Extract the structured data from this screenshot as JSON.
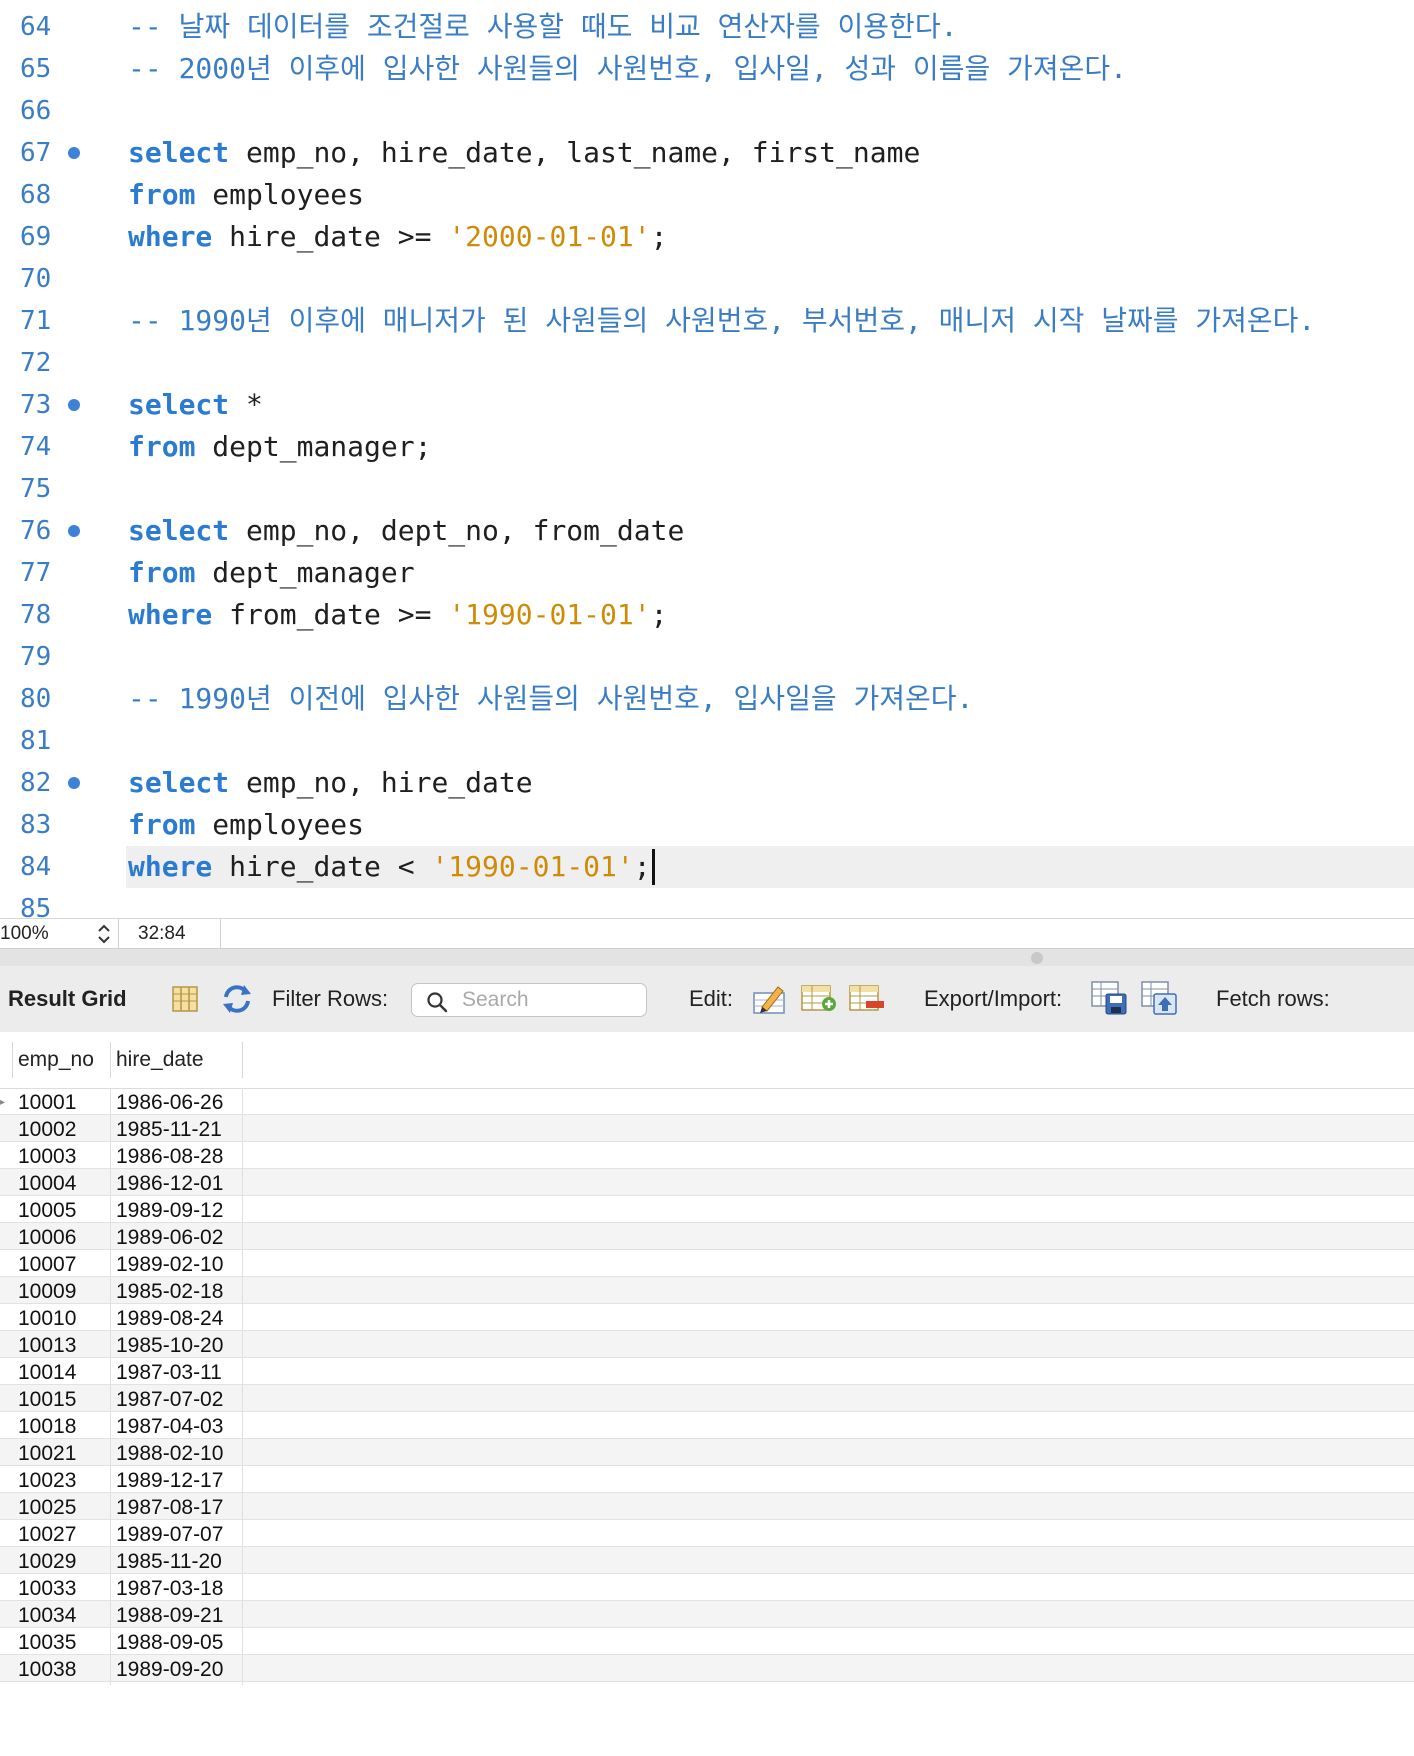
{
  "editor": {
    "lines": [
      {
        "n": "64",
        "dot": false,
        "tokens": [
          {
            "t": "-- 날짜 데이터를 조건절로 사용할 때도 비교 연산자를 이용한다.",
            "c": "cm"
          }
        ]
      },
      {
        "n": "65",
        "dot": false,
        "tokens": [
          {
            "t": "-- 2000년 이후에 입사한 사원들의 사원번호, 입사일, 성과 이름을 가져온다.",
            "c": "cm"
          }
        ]
      },
      {
        "n": "66",
        "dot": false,
        "tokens": []
      },
      {
        "n": "67",
        "dot": true,
        "tokens": [
          {
            "t": "select",
            "c": "kw"
          },
          {
            "t": " emp_no, hire_date, last_name, first_name",
            "c": ""
          }
        ]
      },
      {
        "n": "68",
        "dot": false,
        "tokens": [
          {
            "t": "from",
            "c": "kw"
          },
          {
            "t": " employees",
            "c": ""
          }
        ]
      },
      {
        "n": "69",
        "dot": false,
        "tokens": [
          {
            "t": "where",
            "c": "kw"
          },
          {
            "t": " hire_date >= ",
            "c": ""
          },
          {
            "t": "'2000-01-01'",
            "c": "str"
          },
          {
            "t": ";",
            "c": ""
          }
        ]
      },
      {
        "n": "70",
        "dot": false,
        "tokens": []
      },
      {
        "n": "71",
        "dot": false,
        "tokens": [
          {
            "t": "-- 1990년 이후에 매니저가 된 사원들의 사원번호, 부서번호, 매니저 시작 날짜를 가져온다.",
            "c": "cm"
          }
        ]
      },
      {
        "n": "72",
        "dot": false,
        "tokens": []
      },
      {
        "n": "73",
        "dot": true,
        "tokens": [
          {
            "t": "select",
            "c": "kw"
          },
          {
            "t": " *",
            "c": ""
          }
        ]
      },
      {
        "n": "74",
        "dot": false,
        "tokens": [
          {
            "t": "from",
            "c": "kw"
          },
          {
            "t": " dept_manager;",
            "c": ""
          }
        ]
      },
      {
        "n": "75",
        "dot": false,
        "tokens": []
      },
      {
        "n": "76",
        "dot": true,
        "tokens": [
          {
            "t": "select",
            "c": "kw"
          },
          {
            "t": " emp_no, dept_no, from_date",
            "c": ""
          }
        ]
      },
      {
        "n": "77",
        "dot": false,
        "tokens": [
          {
            "t": "from",
            "c": "kw"
          },
          {
            "t": " dept_manager",
            "c": ""
          }
        ]
      },
      {
        "n": "78",
        "dot": false,
        "tokens": [
          {
            "t": "where",
            "c": "kw"
          },
          {
            "t": " from_date >= ",
            "c": ""
          },
          {
            "t": "'1990-01-01'",
            "c": "str"
          },
          {
            "t": ";",
            "c": ""
          }
        ]
      },
      {
        "n": "79",
        "dot": false,
        "tokens": []
      },
      {
        "n": "80",
        "dot": false,
        "tokens": [
          {
            "t": "-- 1990년 이전에 입사한 사원들의 사원번호, 입사일을 가져온다.",
            "c": "cm"
          }
        ]
      },
      {
        "n": "81",
        "dot": false,
        "tokens": []
      },
      {
        "n": "82",
        "dot": true,
        "tokens": [
          {
            "t": "select",
            "c": "kw"
          },
          {
            "t": " emp_no, hire_date",
            "c": ""
          }
        ]
      },
      {
        "n": "83",
        "dot": false,
        "tokens": [
          {
            "t": "from",
            "c": "kw"
          },
          {
            "t": " employees",
            "c": ""
          }
        ]
      },
      {
        "n": "84",
        "dot": false,
        "current": true,
        "tokens": [
          {
            "t": "where",
            "c": "kw"
          },
          {
            "t": " hire_date < ",
            "c": ""
          },
          {
            "t": "'1990-01-01'",
            "c": "str"
          },
          {
            "t": ";",
            "c": ""
          }
        ]
      },
      {
        "n": "85",
        "dot": false,
        "tokens": []
      }
    ]
  },
  "status": {
    "zoom": "100%",
    "cursor": "32:84"
  },
  "toolbar": {
    "result_grid_label": "Result Grid",
    "filter_label": "Filter Rows:",
    "search_placeholder": "Search",
    "edit_label": "Edit:",
    "export_label": "Export/Import:",
    "fetch_label": "Fetch rows:"
  },
  "grid": {
    "columns": [
      "emp_no",
      "hire_date"
    ],
    "rows": [
      [
        "10001",
        "1986-06-26"
      ],
      [
        "10002",
        "1985-11-21"
      ],
      [
        "10003",
        "1986-08-28"
      ],
      [
        "10004",
        "1986-12-01"
      ],
      [
        "10005",
        "1989-09-12"
      ],
      [
        "10006",
        "1989-06-02"
      ],
      [
        "10007",
        "1989-02-10"
      ],
      [
        "10009",
        "1985-02-18"
      ],
      [
        "10010",
        "1989-08-24"
      ],
      [
        "10013",
        "1985-10-20"
      ],
      [
        "10014",
        "1987-03-11"
      ],
      [
        "10015",
        "1987-07-02"
      ],
      [
        "10018",
        "1987-04-03"
      ],
      [
        "10021",
        "1988-02-10"
      ],
      [
        "10023",
        "1989-12-17"
      ],
      [
        "10025",
        "1987-08-17"
      ],
      [
        "10027",
        "1989-07-07"
      ],
      [
        "10029",
        "1985-11-20"
      ],
      [
        "10033",
        "1987-03-18"
      ],
      [
        "10034",
        "1988-09-21"
      ],
      [
        "10035",
        "1988-09-05"
      ],
      [
        "10038",
        "1989-09-20"
      ]
    ]
  },
  "colors": {
    "keyword": "#2b7bd0",
    "string": "#d08b06",
    "comment": "#3a7dc4",
    "line_number": "#3a7dc4",
    "breakpoint_dot": "#3d82d6"
  }
}
